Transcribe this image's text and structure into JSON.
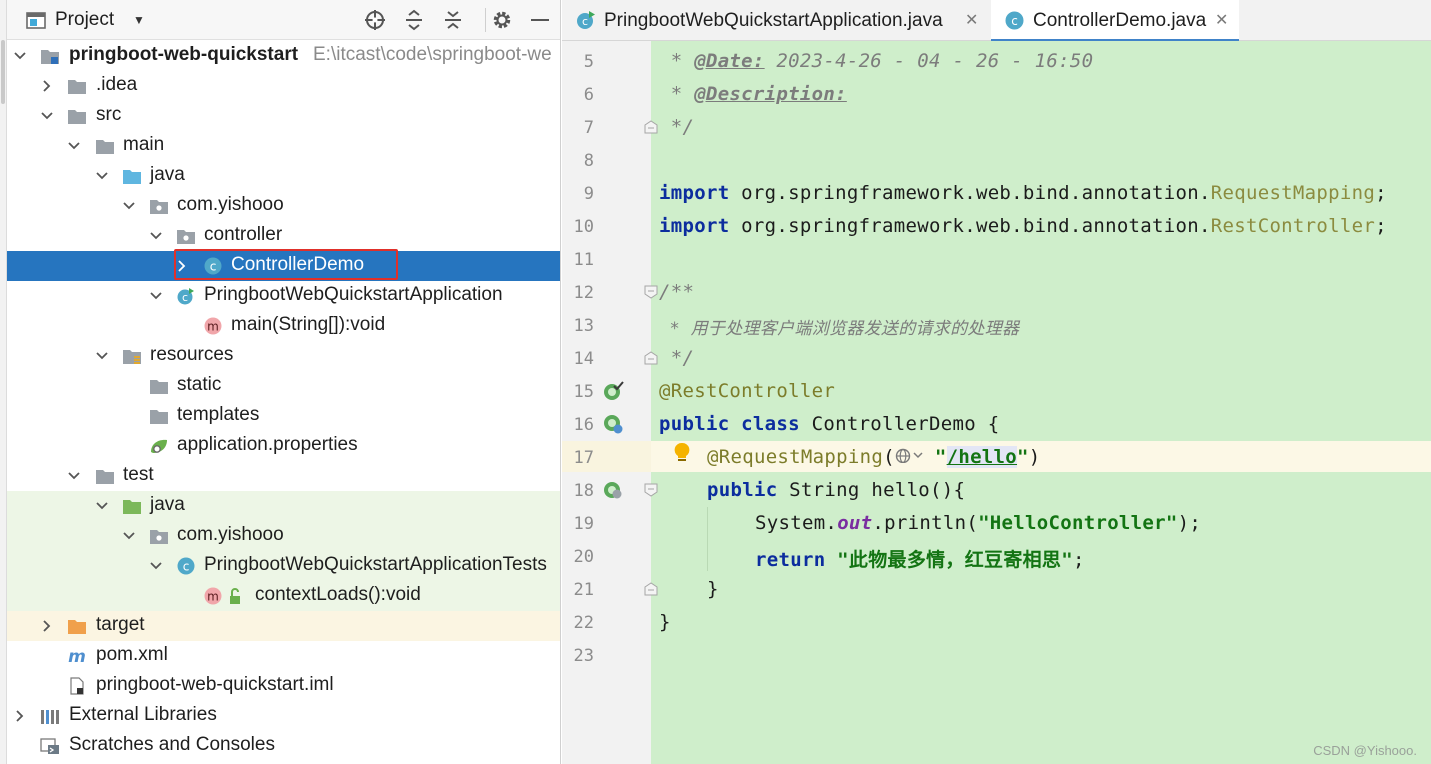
{
  "project_panel": {
    "title": "Project",
    "tree": [
      {
        "label": "pringboot-web-quickstart",
        "path": "E:\\itcast\\code\\springboot-we",
        "icon": "module-folder-icon",
        "arrow": "down"
      },
      {
        "label": ".idea",
        "icon": "folder-icon",
        "arrow": "right"
      },
      {
        "label": "src",
        "icon": "folder-icon",
        "arrow": "down"
      },
      {
        "label": "main",
        "icon": "folder-icon",
        "arrow": "down"
      },
      {
        "label": "java",
        "icon": "source-folder-icon",
        "arrow": "down"
      },
      {
        "label": "com.yishooo",
        "icon": "package-icon",
        "arrow": "down"
      },
      {
        "label": "controller",
        "icon": "package-icon",
        "arrow": "down"
      },
      {
        "label": "ControllerDemo",
        "icon": "class-icon",
        "arrow": "right",
        "selected": true
      },
      {
        "label": "PringbootWebQuickstartApplication",
        "icon": "spring-class-icon",
        "arrow": "down"
      },
      {
        "label": "main(String[]):void",
        "icon": "method-icon",
        "arrow": "none"
      },
      {
        "label": "resources",
        "icon": "resources-folder-icon",
        "arrow": "down"
      },
      {
        "label": "static",
        "icon": "folder-icon",
        "arrow": "none"
      },
      {
        "label": "templates",
        "icon": "folder-icon",
        "arrow": "none"
      },
      {
        "label": "application.properties",
        "icon": "spring-properties-icon",
        "arrow": "none"
      },
      {
        "label": "test",
        "icon": "folder-icon",
        "arrow": "down"
      },
      {
        "label": "java",
        "icon": "test-folder-icon",
        "arrow": "down"
      },
      {
        "label": "com.yishooo",
        "icon": "package-icon",
        "arrow": "down"
      },
      {
        "label": "PringbootWebQuickstartApplicationTests",
        "icon": "class-icon",
        "arrow": "down"
      },
      {
        "label": "contextLoads():void",
        "icon": "method-icon",
        "arrow": "none"
      },
      {
        "label": "target",
        "icon": "excluded-folder-icon",
        "arrow": "right"
      },
      {
        "label": "pom.xml",
        "icon": "maven-icon",
        "arrow": "none"
      },
      {
        "label": "pringboot-web-quickstart.iml",
        "icon": "iml-file-icon",
        "arrow": "none"
      },
      {
        "label": "External Libraries",
        "icon": "libraries-icon",
        "arrow": "right"
      },
      {
        "label": "Scratches and Consoles",
        "icon": "scratches-icon",
        "arrow": "none"
      }
    ]
  },
  "editor": {
    "tabs": [
      {
        "label": "PringbootWebQuickstartApplication.java",
        "close": "✕",
        "active": false
      },
      {
        "label": "ControllerDemo.java",
        "close": "✕",
        "active": true
      }
    ],
    "line_numbers": [
      "5",
      "6",
      "7",
      "8",
      "9",
      "10",
      "11",
      "12",
      "13",
      "14",
      "15",
      "16",
      "17",
      "18",
      "19",
      "20",
      "21",
      "22",
      "23"
    ],
    "code": {
      "l5_prefix": " * ",
      "l5_tag": "@Date:",
      "l5_rest": " 2023-4-26 - 04 - 26 - 16:50",
      "l6_prefix": " * ",
      "l6_tag": "@Description:",
      "l7": " */",
      "l9_kw": "import",
      "l9_pkg": " org.springframework.web.bind.annotation.",
      "l9_cls": "RequestMapping",
      "l9_end": ";",
      "l10_kw": "import",
      "l10_pkg": " org.springframework.web.bind.annotation.",
      "l10_cls": "RestController",
      "l10_end": ";",
      "l12": "/**",
      "l13": " * 用于处理客户端浏览器发送的请求的处理器",
      "l14": " */",
      "l15": "@RestController",
      "l16_kw": "public class",
      "l16_rest": " ControllerDemo {",
      "l17_ann": "@RequestMapping",
      "l17_open": "(",
      "l17_q1": "\"",
      "l17_path": "/hello",
      "l17_q2": "\"",
      "l17_close": ")",
      "l18_kw": "public",
      "l18_rest": " String hello(){",
      "l19_pre": "System.",
      "l19_field": "out",
      "l19_mid": ".println(",
      "l19_str": "\"HelloController\"",
      "l19_end": ");",
      "l20_kw": "return",
      "l20_str": " \"此物最多情，红豆寄相思\"",
      "l20_end": ";",
      "l21": "}",
      "l22": "}"
    }
  },
  "watermark": "CSDN @Yishooo.",
  "colors": {
    "selection": "#2675bf",
    "highlight_box": "#e0302a",
    "code_background": "#cfeecb",
    "keyword": "#0c2d9e",
    "string": "#137413"
  }
}
